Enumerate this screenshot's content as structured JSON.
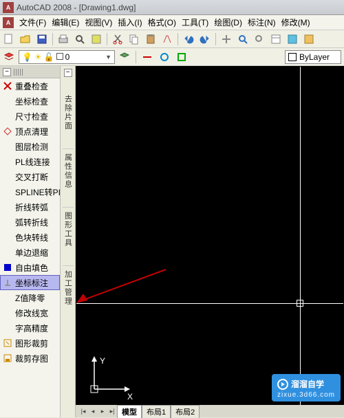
{
  "titlebar": {
    "title": "AutoCAD 2008 - [Drawing1.dwg]",
    "icon": "A"
  },
  "menubar": {
    "icon": "A",
    "items": [
      "文件(F)",
      "编辑(E)",
      "视图(V)",
      "插入(I)",
      "格式(O)",
      "工具(T)",
      "绘图(D)",
      "标注(N)",
      "修改(M)"
    ]
  },
  "layerbar": {
    "layer_name": "0",
    "bylayer": "ByLayer"
  },
  "left_tools": [
    {
      "label": "重叠检查",
      "icon": "x-icon",
      "color": "#cc0000"
    },
    {
      "label": "坐标检查",
      "icon": "",
      "color": ""
    },
    {
      "label": "尺寸检查",
      "icon": "",
      "color": ""
    },
    {
      "label": "顶点清理",
      "icon": "diamond-icon",
      "color": "#cc3333"
    },
    {
      "label": "图层检测",
      "icon": "",
      "color": ""
    },
    {
      "label": "PL线连接",
      "icon": "",
      "color": ""
    },
    {
      "label": "交叉打断",
      "icon": "",
      "color": ""
    },
    {
      "label": "SPLINE转PL",
      "icon": "",
      "color": ""
    },
    {
      "label": "折线转弧",
      "icon": "",
      "color": ""
    },
    {
      "label": "弧转折线",
      "icon": "",
      "color": ""
    },
    {
      "label": "色块转线",
      "icon": "",
      "color": ""
    },
    {
      "label": "单边退缩",
      "icon": "",
      "color": ""
    },
    {
      "label": "自由填色",
      "icon": "square-icon",
      "color": "#0000cc"
    },
    {
      "label": "坐标标注",
      "icon": "marker-icon",
      "color": "#888",
      "selected": true
    },
    {
      "label": "Z值降零",
      "icon": "",
      "color": ""
    },
    {
      "label": "修改线宽",
      "icon": "",
      "color": ""
    },
    {
      "label": "字高精度",
      "icon": "",
      "color": ""
    },
    {
      "label": "图形裁剪",
      "icon": "clip-icon",
      "color": "#cc8800"
    },
    {
      "label": "裁剪存图",
      "icon": "save-icon",
      "color": "#cc8800"
    }
  ],
  "vstrip_labels": [
    "去除片面",
    "属性信息",
    "图形工具",
    "加工管理"
  ],
  "ucs": {
    "x": "X",
    "y": "Y"
  },
  "tabs": {
    "items": [
      "模型",
      "布局1",
      "布局2"
    ],
    "active": 0
  },
  "watermark": {
    "brand": "溜溜自学",
    "url": "zixue.3d66.com"
  }
}
